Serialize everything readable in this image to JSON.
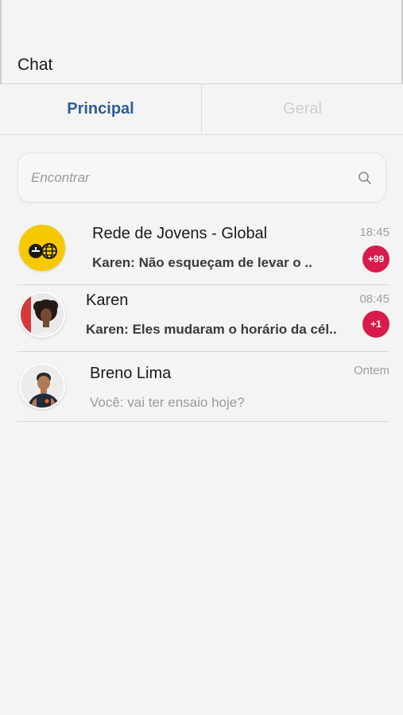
{
  "header": {
    "title": "Chat"
  },
  "tabs": [
    {
      "label": "Principal",
      "active": true
    },
    {
      "label": "Geral",
      "active": false
    }
  ],
  "search": {
    "placeholder": "Encontrar",
    "value": ""
  },
  "chats": [
    {
      "name": "Rede de Jovens - Global",
      "last_message": "Karen: Não esqueçam de levar o ..",
      "time": "18:45",
      "badge": "+99",
      "unread": true,
      "avatar": "group-logo-icon"
    },
    {
      "name": "Karen",
      "last_message": "Karen: Eles mudaram o horário da cél..",
      "time": "08:45",
      "badge": "+1",
      "unread": true,
      "avatar": "user-photo"
    },
    {
      "name": "Breno Lima",
      "last_message": "Você: vai ter ensaio hoje?",
      "time": "Ontem",
      "unread": false,
      "avatar": "user-photo"
    }
  ],
  "colors": {
    "accent": "#2f5d96",
    "badge": "#d81b4a",
    "group_logo_bg": "#f5c800"
  }
}
